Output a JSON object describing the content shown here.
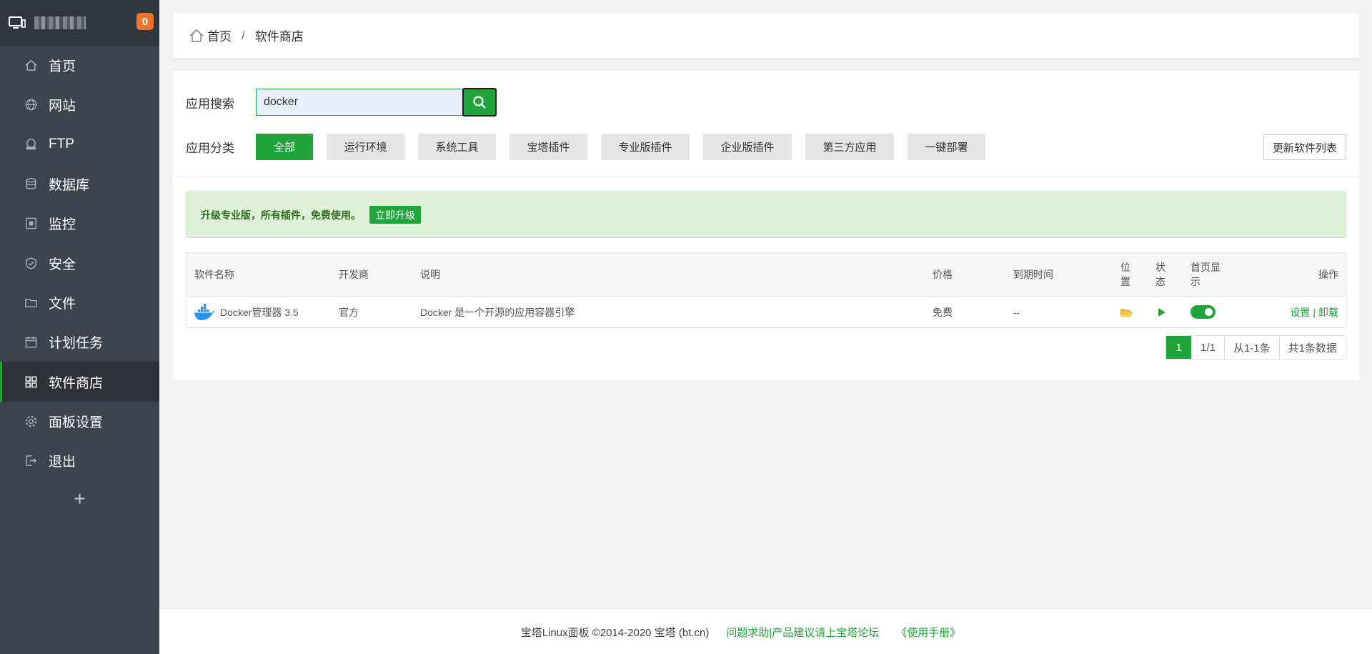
{
  "sidebar": {
    "badge": "0",
    "items": [
      {
        "label": "首页",
        "icon": "home-icon"
      },
      {
        "label": "网站",
        "icon": "globe-icon"
      },
      {
        "label": "FTP",
        "icon": "ftp-icon"
      },
      {
        "label": "数据库",
        "icon": "database-icon"
      },
      {
        "label": "监控",
        "icon": "monitor-icon"
      },
      {
        "label": "安全",
        "icon": "shield-icon"
      },
      {
        "label": "文件",
        "icon": "folder-icon"
      },
      {
        "label": "计划任务",
        "icon": "calendar-icon"
      },
      {
        "label": "软件商店",
        "icon": "grid-icon",
        "active": true
      },
      {
        "label": "面板设置",
        "icon": "gear-icon"
      },
      {
        "label": "退出",
        "icon": "logout-icon"
      }
    ],
    "add_label": "+"
  },
  "breadcrumb": {
    "home": "首页",
    "separator": "/",
    "current": "软件商店"
  },
  "search": {
    "label": "应用搜索",
    "value": "docker"
  },
  "categories": {
    "label": "应用分类",
    "items": [
      "全部",
      "运行环境",
      "系统工具",
      "宝塔插件",
      "专业版插件",
      "企业版插件",
      "第三方应用",
      "一键部署"
    ],
    "update_label": "更新软件列表"
  },
  "promo": {
    "text": "升级专业版，所有插件，免费使用。",
    "button": "立即升级"
  },
  "table": {
    "headers": {
      "name": "软件名称",
      "developer": "开发商",
      "desc": "说明",
      "price": "价格",
      "expire": "到期时间",
      "location_1": "位",
      "location_2": "置",
      "status_1": "状",
      "status_2": "态",
      "homepage_1": "首页显",
      "homepage_2": "示",
      "actions": "操作"
    },
    "rows": [
      {
        "name": "Docker管理器 3.5",
        "developer": "官方",
        "desc": "Docker 是一个开源的应用容器引擎",
        "price": "免费",
        "expire": "--",
        "settings": "设置",
        "sep": "|",
        "uninstall": "卸载"
      }
    ]
  },
  "pager": {
    "current": "1",
    "pages": "1/1",
    "range": "从1-1条",
    "total": "共1条数据"
  },
  "footer": {
    "copyright": "宝塔Linux面板 ©2014-2020 宝塔 (bt.cn)",
    "forum": "问题求助|产品建议请上宝塔论坛",
    "manual": "《使用手册》"
  },
  "colors": {
    "accent": "#20a53a",
    "sidebar": "#3c444d",
    "badge": "#f0732a"
  }
}
